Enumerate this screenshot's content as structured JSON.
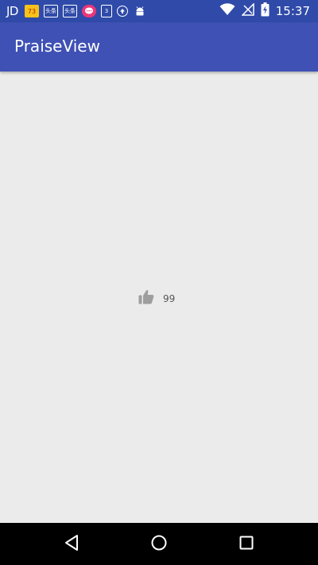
{
  "status_bar": {
    "carrier_logo": "JD",
    "notification_icons": [
      {
        "name": "calendar-73-icon",
        "text": "73"
      },
      {
        "name": "toutiao-icon",
        "text": "头条"
      },
      {
        "name": "toutiao-icon",
        "text": "头条"
      },
      {
        "name": "chat-bubble-icon",
        "text": ""
      },
      {
        "name": "calendar-3-icon",
        "text": "3"
      },
      {
        "name": "upload-arrow-icon",
        "text": ""
      },
      {
        "name": "android-robot-icon",
        "text": ""
      }
    ],
    "time": "15:37",
    "system_icons": [
      "wifi-icon",
      "no-signal-icon",
      "battery-charging-icon"
    ]
  },
  "app_bar": {
    "title": "PraiseView"
  },
  "praise": {
    "icon": "thumbs-up-icon",
    "count": "99"
  },
  "nav_bar": {
    "buttons": [
      "back-button",
      "home-button",
      "recents-button"
    ]
  },
  "colors": {
    "status_bar": "#2f4aa8",
    "app_bar": "#3f51b5",
    "background": "#ebebeb",
    "icon_gray": "#9e9e9e",
    "nav_bar": "#000000"
  }
}
